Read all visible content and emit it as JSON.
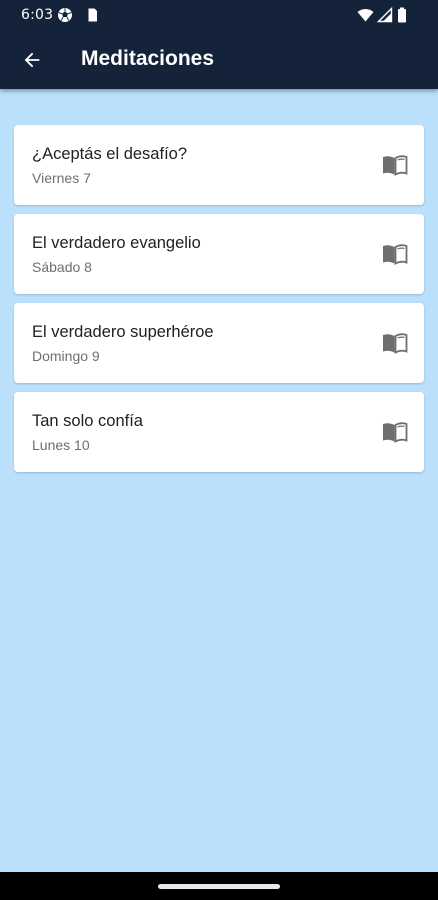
{
  "status_bar": {
    "time": "6:03",
    "left_icons": [
      "soccer-ball-icon",
      "sim-card-icon"
    ],
    "right_icons": [
      "wifi-icon",
      "signal-icon",
      "battery-icon"
    ]
  },
  "app_bar": {
    "back_icon": "arrow-left-icon",
    "title": "Meditaciones"
  },
  "meditations": [
    {
      "title": "¿Aceptás el desafío?",
      "date": "Viernes 7",
      "icon": "open-book-icon"
    },
    {
      "title": "El verdadero evangelio",
      "date": "Sábado 8",
      "icon": "open-book-icon"
    },
    {
      "title": "El verdadero superhéroe",
      "date": "Domingo 9",
      "icon": "open-book-icon"
    },
    {
      "title": "Tan solo confía",
      "date": "Lunes 10",
      "icon": "open-book-icon"
    }
  ],
  "colors": {
    "app_bar": "#14233a",
    "background": "#bbe0fc",
    "card": "#ffffff",
    "title_text": "#212121",
    "subtitle_text": "#6f6f6f",
    "icon": "#6f6f6f"
  }
}
